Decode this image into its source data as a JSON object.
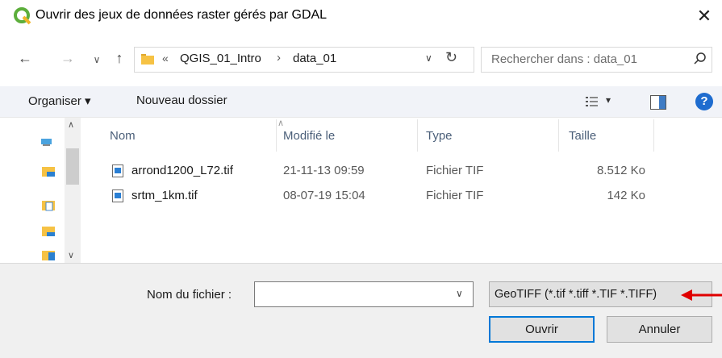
{
  "window": {
    "title": "Ouvrir des jeux de données raster gérés par GDAL",
    "close_glyph": "✕",
    "app_icon": "qgis-logo-icon"
  },
  "address": {
    "overflow": "«",
    "crumbs": [
      "QGIS_01_Intro",
      "data_01"
    ],
    "separator": "›"
  },
  "search": {
    "placeholder": "Rechercher dans : data_01"
  },
  "toolbar": {
    "organiser": "Organiser ▾",
    "nouveau_dossier": "Nouveau dossier",
    "view_dropdown": "▾",
    "help": "?"
  },
  "columns": [
    "Nom",
    "Modifié le",
    "Type",
    "Taille"
  ],
  "files": [
    {
      "name": "arrond1200_L72.tif",
      "modified": "21-11-13 09:59",
      "type": "Fichier TIF",
      "size": "8.512 Ko"
    },
    {
      "name": "srtm_1km.tif",
      "modified": "08-07-19 15:04",
      "type": "Fichier TIF",
      "size": "142 Ko"
    }
  ],
  "bottom": {
    "filename_label": "Nom du fichier :",
    "filename_value": "",
    "filter": "GeoTIFF (*.tif *.tiff *.TIF *.TIFF)",
    "open": "Ouvrir",
    "cancel": "Annuler"
  },
  "colors": {
    "accent": "#0078d7",
    "help": "#1e6ccf",
    "arrow": "#e00000",
    "folder": "#f6c244"
  }
}
